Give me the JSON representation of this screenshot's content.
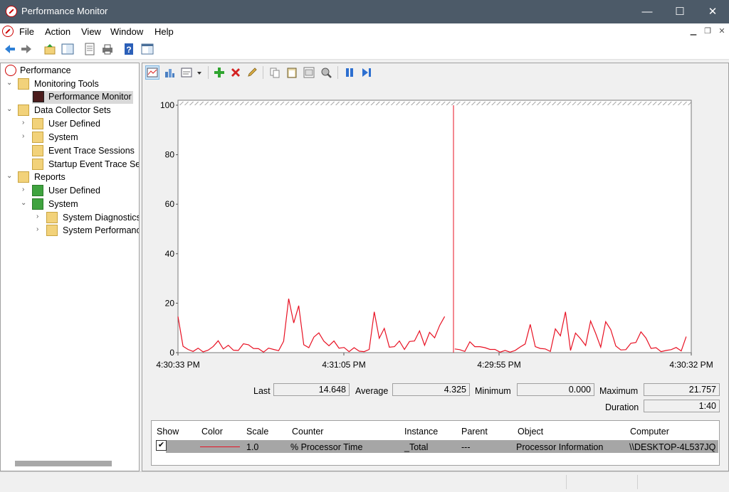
{
  "window": {
    "title": "Performance Monitor",
    "minimize": "—",
    "maximize": "☐",
    "close": "✕"
  },
  "menu": {
    "items": [
      "File",
      "Action",
      "View",
      "Window",
      "Help"
    ]
  },
  "tree": {
    "root": "Performance",
    "monitoring_tools": "Monitoring Tools",
    "performance_monitor": "Performance Monitor",
    "data_collector_sets": "Data Collector Sets",
    "dcs_user_defined": "User Defined",
    "dcs_system": "System",
    "event_trace_sessions": "Event Trace Sessions",
    "startup_event_trace": "Startup Event Trace Sess",
    "reports": "Reports",
    "rep_user_defined": "User Defined",
    "rep_system": "System",
    "system_diagnostics": "System Diagnostics",
    "system_performance": "System Performance"
  },
  "chart_data": {
    "type": "line",
    "ylim": [
      0,
      100
    ],
    "yticks": [
      "100",
      "80",
      "60",
      "40",
      "20",
      "0"
    ],
    "xticks": [
      "4:30:33 PM",
      "4:31:05 PM",
      "4:29:55 PM",
      "4:30:32 PM"
    ],
    "series": [
      {
        "name": "% Processor Time",
        "color": "#e81123",
        "values": [
          14.6,
          2.6,
          1.3,
          0.5,
          1.8,
          0.3,
          1.0,
          2.5,
          4.8,
          1.5,
          3.0,
          1.0,
          0.9,
          3.6,
          3.2,
          1.7,
          1.6,
          0.2,
          1.8,
          1.3,
          0.8,
          4.6,
          21.8,
          12.0,
          19.0,
          3.2,
          2.0,
          6.3,
          8.0,
          4.6,
          2.8,
          4.7,
          1.8,
          2.1,
          0.4,
          2.0,
          0.6,
          0.4,
          1.3,
          16.5,
          5.8,
          9.8,
          2.2,
          2.4,
          4.7,
          1.3,
          4.5,
          4.7,
          8.8,
          3.0,
          8.2,
          6.0,
          11.0,
          14.6,
          null,
          1.5,
          1.2,
          0.5,
          4.4,
          2.4,
          2.4,
          2.0,
          1.3,
          1.3,
          0.2,
          0.9,
          0.2,
          0.9,
          2.3,
          3.5,
          11.4,
          2.4,
          1.7,
          1.5,
          0.5,
          9.6,
          6.8,
          16.5,
          0.9,
          7.9,
          5.6,
          2.9,
          12.8,
          7.8,
          2.2,
          12.5,
          9.3,
          2.7,
          1.1,
          1.2,
          3.8,
          4.1,
          8.4,
          5.9,
          1.7,
          2.0,
          0.4,
          0.9,
          1.2,
          2.1,
          0.7,
          6.5
        ]
      }
    ]
  },
  "stats": {
    "last_label": "Last",
    "last": "14.648",
    "avg_label": "Average",
    "avg": "4.325",
    "min_label": "Minimum",
    "min": "0.000",
    "max_label": "Maximum",
    "max": "21.757",
    "dur_label": "Duration",
    "dur": "1:40"
  },
  "legend": {
    "headers": [
      "Show",
      "Color",
      "Scale",
      "Counter",
      "Instance",
      "Parent",
      "Object",
      "Computer"
    ],
    "row": {
      "checked": "✔",
      "scale": "1.0",
      "counter": "% Processor Time",
      "instance": "_Total",
      "parent": "---",
      "object": "Processor Information",
      "computer": "\\\\DESKTOP-4L537JQ",
      "color": "#e81123"
    }
  }
}
